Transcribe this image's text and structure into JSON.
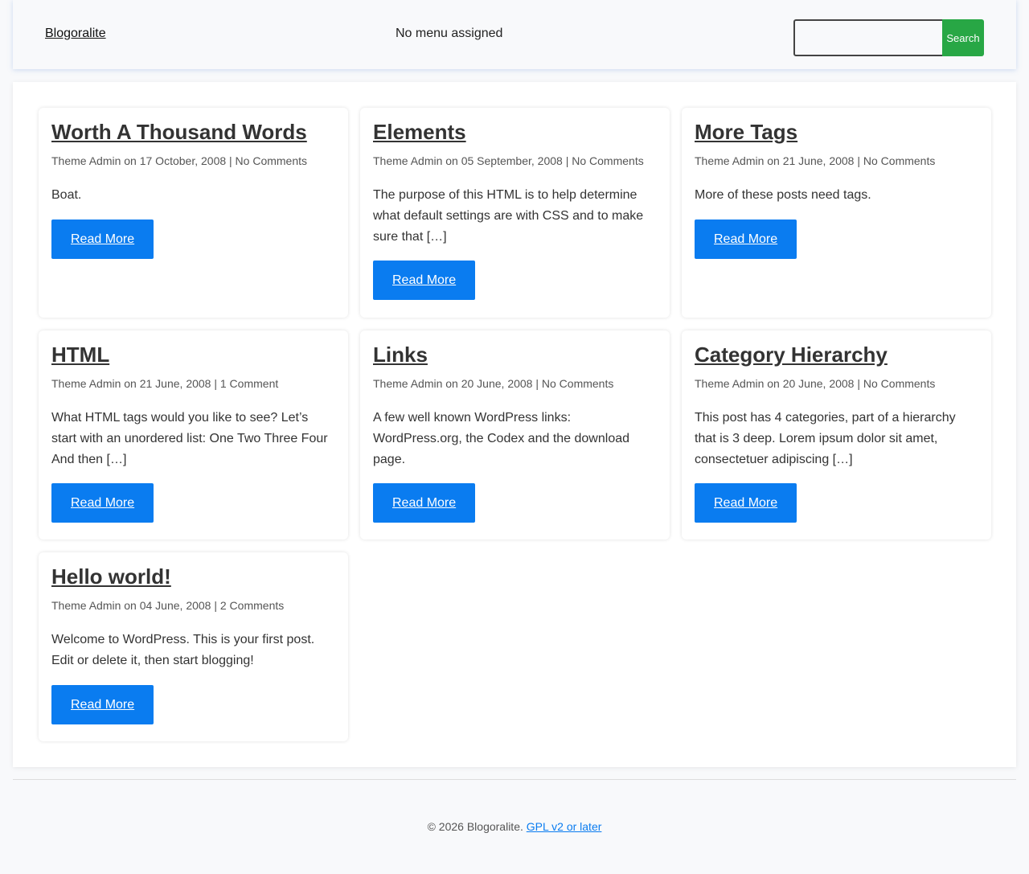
{
  "header": {
    "site_title": "Blogoralite",
    "nav_note": "No menu assigned",
    "search_placeholder": "",
    "search_button": "Search"
  },
  "posts": [
    {
      "title": "Worth A Thousand Words",
      "meta": "Theme Admin on 17 October, 2008 | No Comments",
      "excerpt": "Boat.",
      "read_more": "Read More"
    },
    {
      "title": "Elements",
      "meta": "Theme Admin on 05 September, 2008 | No Comments",
      "excerpt": "The purpose of this HTML is to help determine what default settings are with CSS and to make sure that […]",
      "read_more": "Read More"
    },
    {
      "title": "More Tags",
      "meta": "Theme Admin on 21 June, 2008 | No Comments",
      "excerpt": "More of these posts need tags.",
      "read_more": "Read More"
    },
    {
      "title": "HTML",
      "meta": "Theme Admin on 21 June, 2008 | 1 Comment",
      "excerpt": "What HTML tags would you like to see? Let’s start with an unordered list: One Two Three Four And then […]",
      "read_more": "Read More"
    },
    {
      "title": "Links",
      "meta": "Theme Admin on 20 June, 2008 | No Comments",
      "excerpt": "A few well known WordPress links: WordPress.org, the Codex and the download page.",
      "read_more": "Read More"
    },
    {
      "title": "Category Hierarchy",
      "meta": "Theme Admin on 20 June, 2008 | No Comments",
      "excerpt": "This post has 4 categories, part of a hierarchy that is 3 deep. Lorem ipsum dolor sit amet, consectetuer adipiscing […]",
      "read_more": "Read More"
    },
    {
      "title": "Hello world!",
      "meta": "Theme Admin on 04 June, 2008 | 2 Comments",
      "excerpt": "Welcome to WordPress. This is your first post. Edit or delete it, then start blogging!",
      "read_more": "Read More"
    }
  ],
  "footer": {
    "copyright": "© 2026 Blogoralite.",
    "license_link": "GPL v2 or later"
  },
  "colors": {
    "accent": "#0a7cf0",
    "search_button": "#28a745",
    "background": "#f8f9fb"
  }
}
